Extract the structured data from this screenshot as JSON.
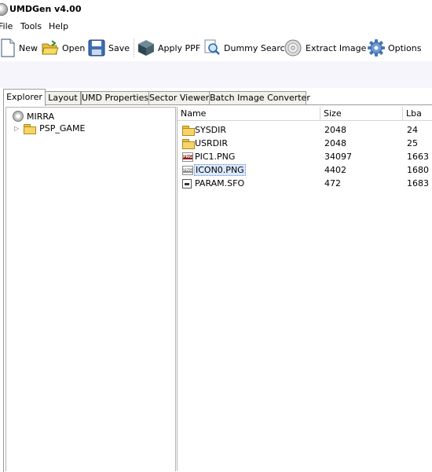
{
  "window": {
    "title": "UMDGen v4.00"
  },
  "menu": {
    "items": [
      "File",
      "Tools",
      "Help"
    ]
  },
  "toolbar": {
    "new_label": "New",
    "open_label": "Open",
    "save_label": "Save",
    "apply_ppf_label": "Apply PPF",
    "dummy_search_label": "Dummy Search",
    "extract_image_label": "Extract Image",
    "options_label": "Options"
  },
  "tabs": [
    "Explorer",
    "Layout",
    "UMD Properties",
    "Sector Viewer",
    "Batch Image Converter"
  ],
  "active_tab": "Explorer",
  "tree": {
    "root": {
      "label": "MIRRA",
      "icon": "disc-icon"
    },
    "children": [
      {
        "label": "PSP_GAME",
        "icon": "folder-icon"
      }
    ]
  },
  "file_list": {
    "columns": [
      "Name",
      "Size",
      "Lba"
    ],
    "rows": [
      {
        "name": "SYSDIR",
        "size": "2048",
        "lba": "24",
        "icon": "folder-icon"
      },
      {
        "name": "USRDIR",
        "size": "2048",
        "lba": "25",
        "icon": "folder-icon"
      },
      {
        "name": "PIC1.PNG",
        "size": "34097",
        "lba": "1663",
        "icon": "png-file-icon"
      },
      {
        "name": "ICON0.PNG",
        "size": "4402",
        "lba": "1680",
        "icon": "png-file-icon"
      },
      {
        "name": "PARAM.SFO",
        "size": "472",
        "lba": "1683",
        "icon": "sfo-file-icon"
      }
    ],
    "selected_row": "ICON0.PNG"
  }
}
